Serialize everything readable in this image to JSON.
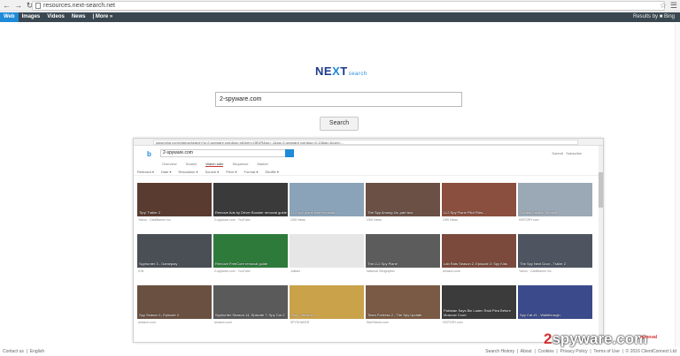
{
  "browser": {
    "url": "resources.next-search.net"
  },
  "topbar": {
    "tabs": [
      "Web",
      "Images",
      "Videos",
      "News",
      "| More »"
    ],
    "results_by": "Results by ■ Bing"
  },
  "logo": {
    "main_a": "NE",
    "main_x": "X",
    "main_b": "T",
    "sub": "search"
  },
  "search": {
    "value": "2-spyware.com",
    "button": "Search"
  },
  "embedded": {
    "url": "www.bing.com/videos/search?q=2-spyware.com&qs=n&form=QBVR&sp=-1&pq=2-spyware.com&sc=0-13&sk=&cvid=...",
    "logo": "b",
    "query": "2-spyware.com",
    "tabs": [
      "Overview",
      "Search",
      "Watch later",
      "Sequence",
      "Market"
    ],
    "filters": [
      "Relevant ▾",
      "Date ▾",
      "Resolution ▾",
      "Source ▾",
      "Price ▾",
      "Format ▾",
      "Shuffle ▾"
    ],
    "right": "Submit   Subscribe",
    "videos": [
      {
        "cap": "'Spy' Trailer 2",
        "meta": "Yahoo · CabiBlamer Inc",
        "color": "#5a3b30"
      },
      {
        "cap": "Remove Ads by Driver Booster removal guide",
        "meta": "2-spyware.com · YouTube",
        "color": "#3a3a3a"
      },
      {
        "cap": "U-2 spy plane pilot explains...",
        "meta": "CBS News",
        "color": "#8aa3b8"
      },
      {
        "cap": "The Spy Among Us, part two",
        "meta": "CBS News",
        "color": "#6b5046"
      },
      {
        "cap": "U-2 Spy Plane Pilot Flies...",
        "meta": "CBS News",
        "color": "#8a4f3e"
      },
      {
        "cap": "Soviets Launch Sputnik",
        "meta": "HISTORY.com",
        "color": "#9ba8b5"
      },
      {
        "cap": "Spyhunter 3 - Gameplay",
        "meta": "IGN",
        "color": "#4a4e55"
      },
      {
        "cap": "Remove FreeCore removal guide",
        "meta": "2-spyware.com · YouTube",
        "color": "#2e7a3b"
      },
      {
        "cap": "",
        "meta": "Jukiact",
        "color": "#e6e6e6"
      },
      {
        "cap": "The U-2 Spy Plane",
        "meta": "National Geographic",
        "color": "#5c5c5c"
      },
      {
        "cap": "Lab Rats Season 2, Episode 2: Spy Kids",
        "meta": "amazon.com",
        "color": "#7b4a3c"
      },
      {
        "cap": "The Spy Next Door - Trailer 2",
        "meta": "Yahoo · CabiBlamer Inc",
        "color": "#4e5560"
      },
      {
        "cap": "Spy Season 1, Episode 2",
        "meta": "amazon.com",
        "color": "#6a5040"
      },
      {
        "cap": "Spyhunter Season 14, Episode 7: Spy Car 2",
        "meta": "amazon.com",
        "color": "#5a5a5a"
      },
      {
        "cap": "Spy - Version 1",
        "meta": "SPYSHAKER",
        "color": "#c9a24a"
      },
      {
        "cap": "Team Fortress 2 - The Spy Update",
        "meta": "StarStArea.com",
        "color": "#7a5a44"
      },
      {
        "cap": "Pakistan Says Bin Laden Raid Plea Before Moscow Court",
        "meta": "HISTORY.com",
        "color": "#3b3b3b"
      },
      {
        "cap": "Spy Cat #1 - Walkthrough",
        "meta": "",
        "color": "#3b4a8a"
      }
    ]
  },
  "footer": {
    "left": "Contact us  |  English",
    "right": "Search History  |  About  |  Cookies  |  Privacy Policy  |  Terms of Use  |  © 2016 ClientConnect Ltd"
  },
  "watermark": {
    "two": "2",
    "rest": "spyware.com",
    "tag": "removal"
  }
}
